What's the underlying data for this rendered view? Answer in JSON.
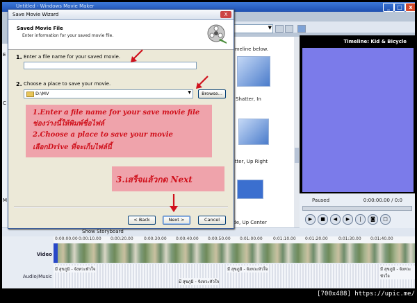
{
  "app": {
    "window_title": "Untitled - Windows Movie Maker"
  },
  "side_text": {
    "timeline_hint": "timeline below.",
    "effect_1": "Shatter, In",
    "effect_2": "hatter, Up Right",
    "effect_3": "ade, Up Center"
  },
  "preview": {
    "title": "Timeline: Kid & Bicycle",
    "status": "Paused",
    "time": "0:00:00.00 / 0:0"
  },
  "timeline": {
    "show_storyboard": "Show Storyboard",
    "video_label": "Video",
    "audio_label": "Audio/Music",
    "ticks": [
      "0:00:00.00",
      "0:00:10.00",
      "0:00:20.00",
      "0:00:30.00",
      "0:00:40.00",
      "0:00:50.00",
      "0:01:00.00",
      "0:01:10.00",
      "0:01:20.00",
      "0:01:30.00",
      "0:01:40.00"
    ],
    "audio_clips": [
      "มี สุขภูมิ - จังหวะหัวใจ",
      "มี สุขภูมิ - จังหวะหัวใจ",
      "มี สุขภูมิ - จังหวะหัวใจ",
      "มี สุขภูมิ - จังหวะหัวใจ"
    ]
  },
  "dialog": {
    "title": "Save Movie Wizard",
    "close": "X",
    "header_title": "Saved Movie File",
    "header_sub": "Enter information for your saved movie file.",
    "step1_num": "1.",
    "step1_label": "Enter a file name for your saved movie.",
    "filename_value": "",
    "step2_num": "2.",
    "step2_label": "Choose a place to save your movie.",
    "location_value": "D:\\MV",
    "browse": "Browse...",
    "back": "< Back",
    "next": "Next >",
    "cancel": "Cancel"
  },
  "annotations": {
    "line1": "1.Enter a file name for your save movie file",
    "line2": "ช่องว่างนี้ให้พิมพ์ชื่อไฟล์",
    "line3": "2.Choose a place to save your movie",
    "line4": "เลือกDrive ที่จะเก็บไฟล์นี้",
    "line5": "3.เสร็จแล้วกด Next"
  },
  "caption": "[700x488] https://upic.me/",
  "colors": {
    "annotation_red": "#d0111c",
    "annotation_bg": "#efa3ab",
    "preview_screen": "#7b7bea"
  }
}
